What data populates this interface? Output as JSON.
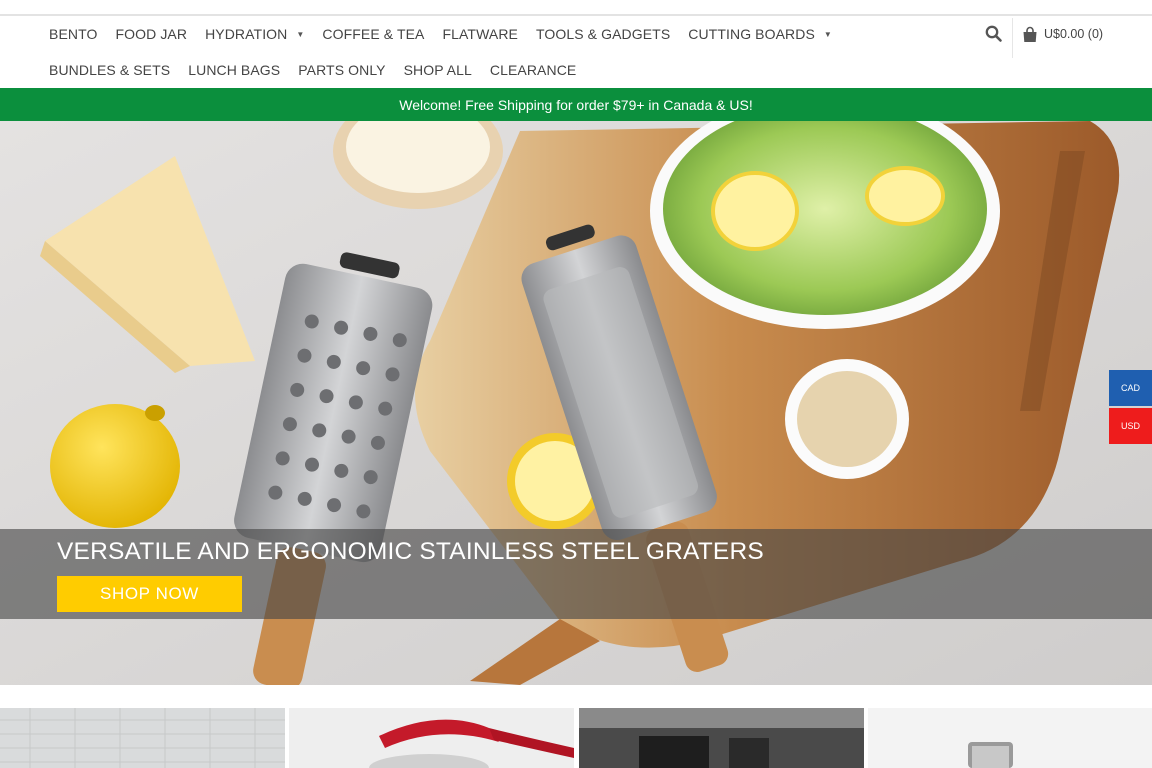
{
  "nav": {
    "row1": [
      {
        "label": "BENTO",
        "has_dropdown": false
      },
      {
        "label": "FOOD JAR",
        "has_dropdown": false
      },
      {
        "label": "HYDRATION",
        "has_dropdown": true
      },
      {
        "label": "COFFEE & TEA",
        "has_dropdown": false
      },
      {
        "label": "FLATWARE",
        "has_dropdown": false
      },
      {
        "label": "TOOLS & GADGETS",
        "has_dropdown": false
      },
      {
        "label": "CUTTING BOARDS",
        "has_dropdown": true
      }
    ],
    "row2": [
      {
        "label": "BUNDLES & SETS"
      },
      {
        "label": "LUNCH BAGS"
      },
      {
        "label": "PARTS ONLY"
      },
      {
        "label": "SHOP ALL"
      },
      {
        "label": "CLEARANCE"
      }
    ],
    "search_icon": "search-icon",
    "cart_icon": "shopping-bag-icon",
    "cart_label": "U$0.00 (0)"
  },
  "promo": {
    "text": "Welcome! Free Shipping for order $79+ in Canada & US!",
    "color": "#0b8f3d"
  },
  "hero": {
    "title": "VERSATILE AND ERGONOMIC STAINLESS STEEL GRATERS",
    "button": "SHOP NOW",
    "button_color": "#ffcc00"
  },
  "currency": {
    "options": [
      "CAD",
      "USD"
    ],
    "cad_color": "#1f5fb0",
    "usd_color": "#ee1c1c"
  }
}
